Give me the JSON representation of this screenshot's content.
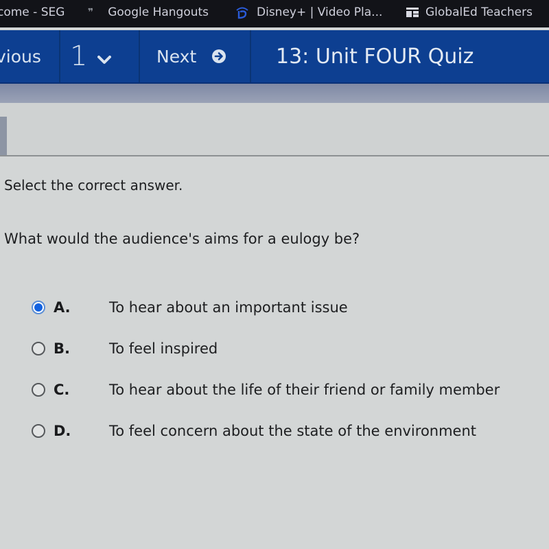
{
  "bookmarks": [
    {
      "label": "come - SEG",
      "icon": "none"
    },
    {
      "label": "Google Hangouts",
      "icon": "hangouts-quote-icon"
    },
    {
      "label": "Disney+ | Video Pla...",
      "icon": "disney-plus-icon"
    },
    {
      "label": "GlobalEd Teachers",
      "icon": "globaled-icon"
    }
  ],
  "nav": {
    "previous_label": "vious",
    "page_number": "1",
    "next_label": "Next",
    "title": "13: Unit FOUR Quiz"
  },
  "quiz": {
    "instruction": "Select the correct answer.",
    "question": "What would the audience's aims for a eulogy be?",
    "selected": "A",
    "options": [
      {
        "letter": "A.",
        "text": "To hear about an important issue"
      },
      {
        "letter": "B.",
        "text": "To feel inspired"
      },
      {
        "letter": "C.",
        "text": "To hear about the life of their friend or family member"
      },
      {
        "letter": "D.",
        "text": "To feel concern about the state of the environment"
      }
    ]
  },
  "colors": {
    "nav_blue": "#0d3f91",
    "radio_selected": "#1463e0",
    "bookmarks_bg": "#121318"
  }
}
